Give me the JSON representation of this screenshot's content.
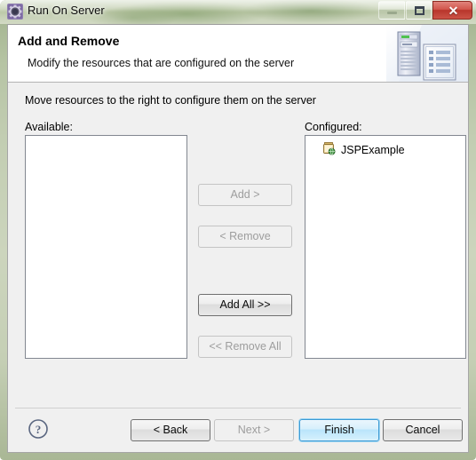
{
  "window": {
    "title": "Run On Server",
    "icon": "run-on-server-gear-icon",
    "controls": {
      "minimize": "minimize-icon",
      "maximize": "restore-icon",
      "close": "✕"
    },
    "frame_color": "#c2cdb2"
  },
  "header": {
    "title": "Add and Remove",
    "description": "Modify the resources that are configured on the server",
    "artwork": "server-and-document-icon"
  },
  "body": {
    "instruction": "Move resources to the right to configure them on the server",
    "available": {
      "label": "Available:",
      "items": []
    },
    "configured": {
      "label": "Configured:",
      "items": [
        {
          "label": "JSPExample",
          "icon": "web-project-icon"
        }
      ]
    },
    "transfer_buttons": [
      {
        "label": "Add >",
        "name": "add-button",
        "enabled": false
      },
      {
        "label": "< Remove",
        "name": "remove-button",
        "enabled": false
      },
      {
        "label": "Add All >>",
        "name": "add-all-button",
        "enabled": true
      },
      {
        "label": "<< Remove All",
        "name": "remove-all-button",
        "enabled": false
      }
    ]
  },
  "footer": {
    "help_icon": "help-question-icon",
    "buttons": {
      "back": "< Back",
      "next": "Next >",
      "finish": "Finish",
      "cancel": "Cancel"
    }
  },
  "colors": {
    "default_button_border": "#3c9ad4",
    "dialog_background": "#f0f0f0",
    "header_background": "#ffffff",
    "close_button": "#b8352b"
  }
}
